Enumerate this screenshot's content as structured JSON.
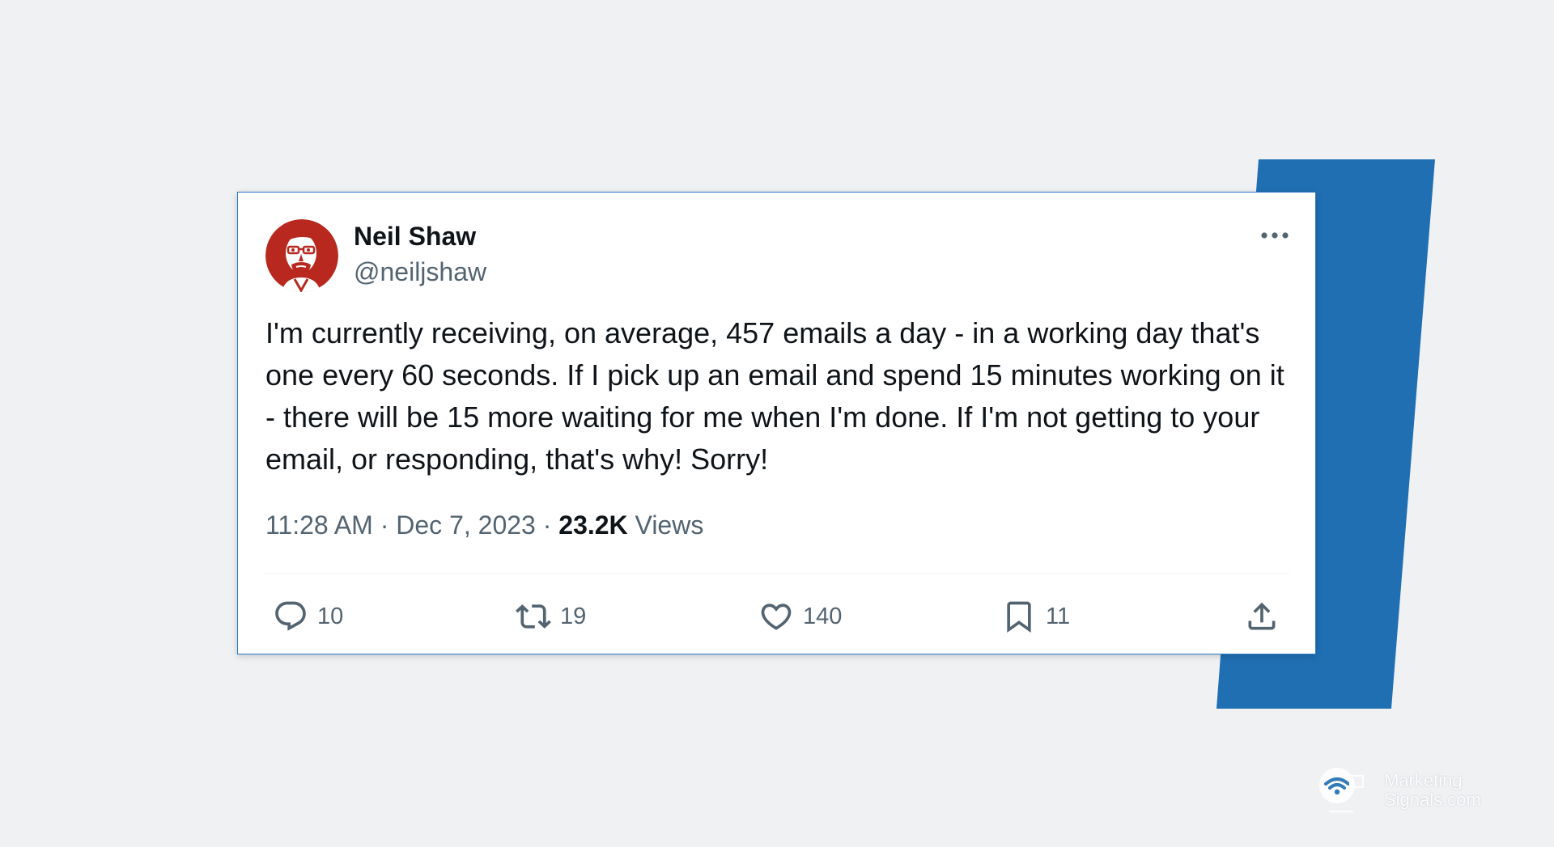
{
  "colors": {
    "background": "#eff1f3",
    "accent_blue": "#1f6fb2",
    "card_border": "#2b78c5",
    "text_primary": "#0f1419",
    "text_secondary": "#536471",
    "avatar_red": "#b8281f"
  },
  "tweet": {
    "author": {
      "name": "Neil Shaw",
      "handle": "@neiljshaw",
      "avatar_icon": "avatar-portrait-icon"
    },
    "text": "I'm currently receiving, on average, 457 emails a day - in a working day that's one every 60 seconds. If I pick up an email and spend 15 minutes working on it - there will be 15 more waiting for me when I'm done. If I'm not getting to your email, or responding, that's why! Sorry!",
    "time": "11:28 AM",
    "separator": "·",
    "date": "Dec 7, 2023",
    "views_count": "23.2K",
    "views_label": "Views",
    "more_icon": "more-options-icon",
    "actions": {
      "reply": {
        "icon": "reply-icon",
        "count": "10"
      },
      "retweet": {
        "icon": "retweet-icon",
        "count": "19"
      },
      "like": {
        "icon": "heart-icon",
        "count": "140"
      },
      "bookmark": {
        "icon": "bookmark-icon",
        "count": "11"
      },
      "share": {
        "icon": "share-icon"
      }
    }
  },
  "watermark": {
    "line1": "Marketing",
    "line2": "Signals.com",
    "icon": "wifi-signal-icon"
  }
}
